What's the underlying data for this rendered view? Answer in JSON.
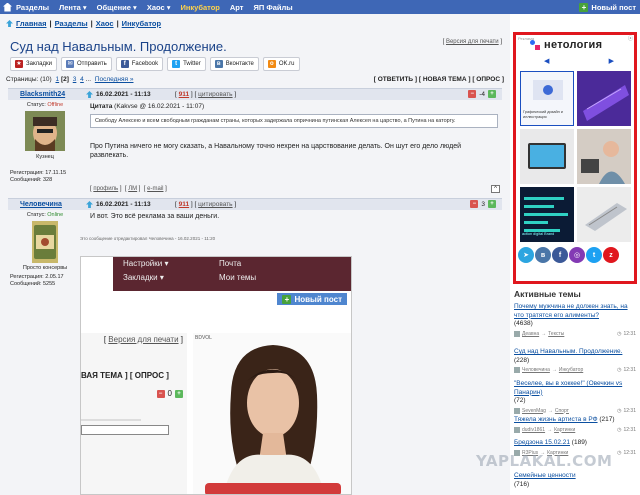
{
  "topnav": {
    "items": [
      "Разделы",
      "Лента",
      "Общение",
      "Хаос",
      "Инкубатор",
      "Арт",
      "ЯП Файлы"
    ],
    "dropdown_marks": [
      "",
      "▾",
      "▾",
      "▾",
      "",
      "",
      ""
    ],
    "new_post": "Новый пост"
  },
  "breadcrumb": [
    "Главная",
    "Разделы",
    "Хаос",
    "Инкубатор"
  ],
  "title": "Суд над Навальным. Продолжение.",
  "print_version": "Версия для печати",
  "share": [
    "Закладки",
    "Отправить",
    "Facebook",
    "Twitter",
    "Вконтакте",
    "OK.ru"
  ],
  "pager": {
    "label": "Страницы: (10)",
    "pages": [
      "1",
      "2",
      "3",
      "4",
      "...",
      "Последняя »"
    ],
    "actions": "[ ОТВЕТИТЬ ] [ НОВАЯ ТЕМА ] [ ОПРОС ]"
  },
  "posts": [
    {
      "author": "Blacksmith24",
      "date": "16.02.2021 - 11:13",
      "num": "911",
      "quote_link": "цитировать",
      "score": "-4",
      "status_label": "Статус:",
      "status": "Offline",
      "avatar_caption": "Кузнец",
      "reg": "Регистрация: 17.11.15",
      "msgs": "Сообщений: 328",
      "quote_title": "Цитата",
      "quote_meta": "(Kakvse @ 16.02.2021 - 11:07)",
      "quote_text": "Свободу Алексею и всем свободным гражданам страны, которых задержала опричнина путинская Алексея на царство, а Путина на каторгу.",
      "text": "Про Путина ничего не могу сказать, а Навальному точно нехрен на царствование делать. Он шут его дело людей развлекать.",
      "footer": [
        "профиль",
        "ЛМ",
        "e-mail"
      ]
    },
    {
      "author": "Человечина",
      "date": "16.02.2021 - 11:13",
      "num": "911",
      "quote_link": "цитировать",
      "score": "3",
      "status_label": "Статус:",
      "status": "Online",
      "avatar_caption": "Просто консервы",
      "reg": "Регистрация: 2.05.17",
      "msgs": "Сообщений: 5255",
      "text": "И вот. Это всё реклама за ваши деньги.",
      "edited": "Это сообщение отредактировал Человечина - 16.02.2021 - 11:20"
    }
  ],
  "embedded": {
    "menu": [
      "Настройки ▾",
      "Почта",
      "Закладки ▾",
      "Мои темы"
    ],
    "new_post": "Новый пост",
    "print": "Версия для печати",
    "actions": "ВАЯ ТЕМА ] [ ОПРОС ]",
    "votes": "0",
    "photo_tag": "BDVOL"
  },
  "ad": {
    "brand": "нетология",
    "tag": "Реклама",
    "tile_text": "Графический дизайн и иллюстрация",
    "code_text": "action digital Brand"
  },
  "active": {
    "title": "Активные темы",
    "topics": [
      {
        "title": "Почему мужчина не должен знать, на что тратятся его алименты?",
        "count": "(4638)",
        "user": "Деавна",
        "section": "Тексты",
        "time": "12:31"
      },
      {
        "title": "Суд над Навальным. Продолжение.",
        "count": "(228)",
        "user": "Человечина",
        "section": "Инкубатор",
        "time": "12:31"
      },
      {
        "title": "\"Веселее, вы в хоккее!\" (Овечкин vs Панарин)",
        "count": "(72)",
        "user": "SevenMag",
        "section": "Спорт",
        "time": "12:31"
      },
      {
        "title": "Тяжела жизнь артиста в РФ",
        "count": "(217)",
        "user": "dudiv1861",
        "section": "Картинки",
        "time": "12:31"
      },
      {
        "title": "Бредзона 15.02.21",
        "count": "(189)",
        "user": "R3Pius",
        "section": "Картинки",
        "time": "12:31"
      },
      {
        "title": "Семейные ценности",
        "count": "(716)",
        "user": "",
        "section": "",
        "time": ""
      }
    ]
  },
  "watermark": "YAPLAKAL.COM"
}
